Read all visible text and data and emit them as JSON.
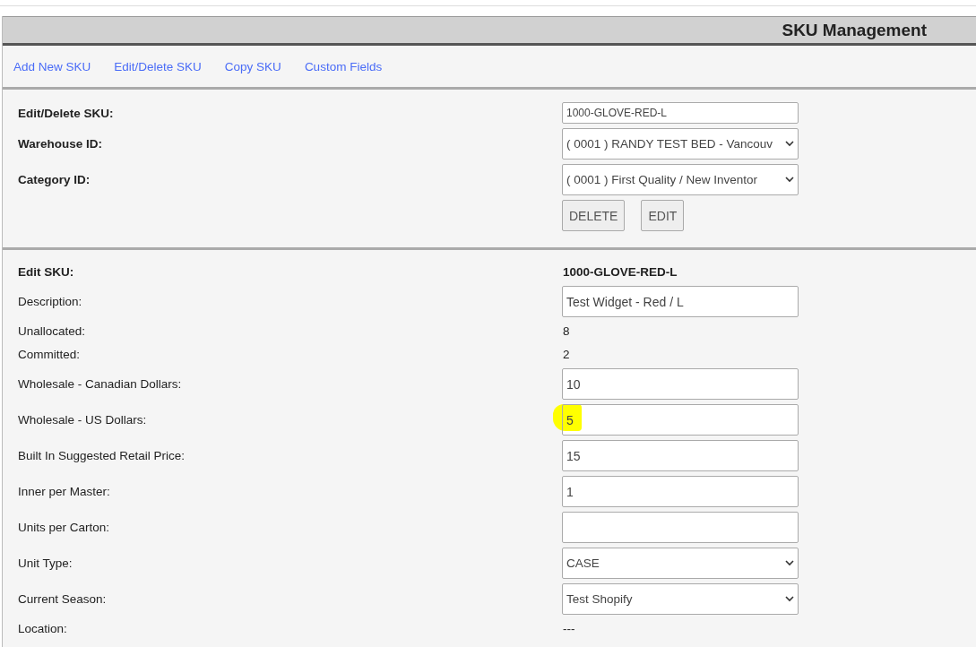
{
  "header": {
    "title": "SKU Management"
  },
  "nav": [
    {
      "label": "Add New SKU"
    },
    {
      "label": "Edit/Delete SKU"
    },
    {
      "label": "Copy SKU"
    },
    {
      "label": "Custom Fields"
    }
  ],
  "lookup": [
    {
      "kind": "input",
      "label": "Edit/Delete SKU:",
      "value": "1000-GLOVE-RED-L"
    },
    {
      "kind": "select",
      "label": "Warehouse ID:",
      "value": "( 0001 ) RANDY TEST BED - Vancouv"
    },
    {
      "kind": "select",
      "label": "Category ID:",
      "value": "( 0001 ) First Quality / New Inventor"
    },
    {
      "kind": "buttons",
      "buttons": [
        "DELETE",
        "EDIT"
      ]
    }
  ],
  "edit": [
    {
      "kind": "heading",
      "label": "Edit SKU:",
      "value": "1000-GLOVE-RED-L"
    },
    {
      "kind": "input",
      "label": "Description:",
      "value": "Test Widget - Red / L"
    },
    {
      "kind": "text",
      "label": "Unallocated:",
      "value": "8"
    },
    {
      "kind": "text",
      "label": "Committed:",
      "value": "2"
    },
    {
      "kind": "input",
      "label": "Wholesale - Canadian Dollars:",
      "value": "10"
    },
    {
      "kind": "input",
      "label": "Wholesale - US Dollars:",
      "value": "5",
      "highlighted": true
    },
    {
      "kind": "input",
      "label": "Built In Suggested Retail Price:",
      "value": "15"
    },
    {
      "kind": "input",
      "label": "Inner per Master:",
      "value": "1"
    },
    {
      "kind": "input",
      "label": "Units per Carton:"
    },
    {
      "kind": "select",
      "label": "Unit Type:",
      "value": "CASE"
    },
    {
      "kind": "select",
      "label": "Current Season:",
      "value": "Test Shopify"
    },
    {
      "kind": "text",
      "label": "Location:",
      "value": "---"
    }
  ]
}
